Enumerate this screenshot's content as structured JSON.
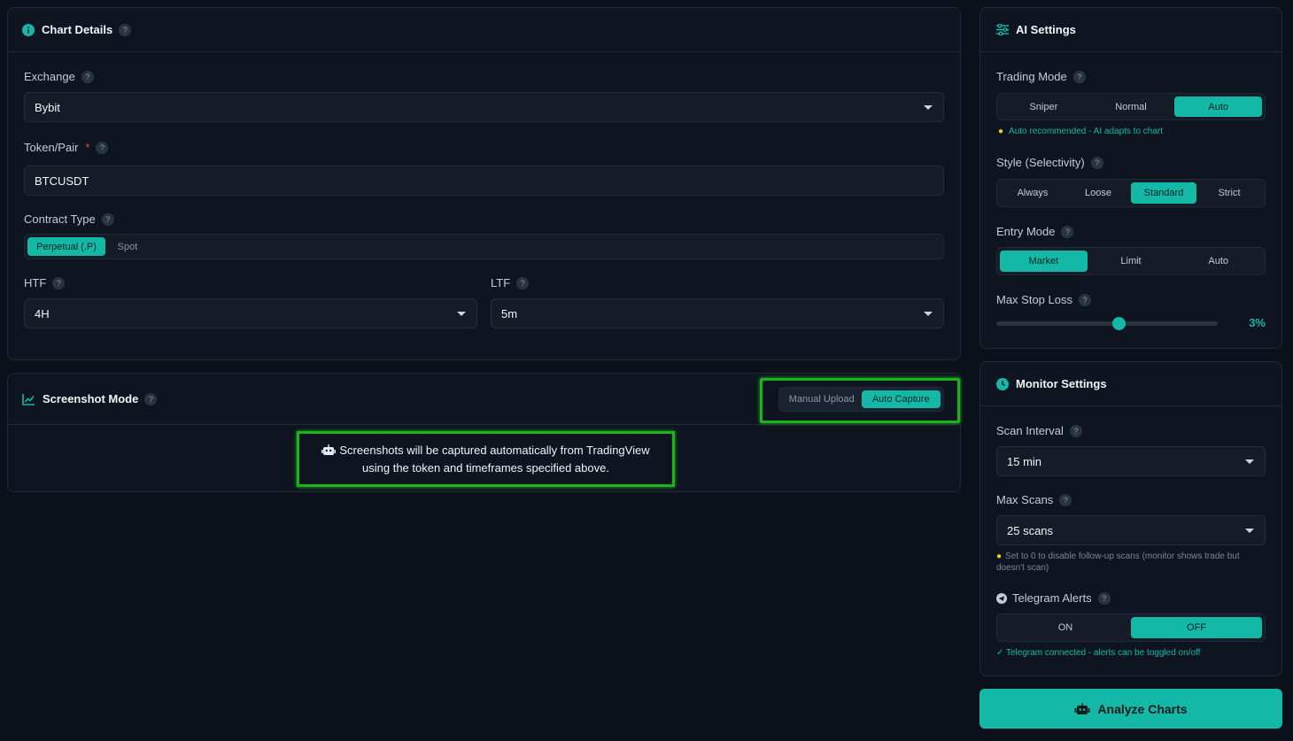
{
  "chart_details": {
    "title": "Chart Details",
    "exchange_label": "Exchange",
    "exchange_value": "Bybit",
    "token_label": "Token/Pair",
    "token_value": "BTCUSDT",
    "contract_label": "Contract Type",
    "contract_options": [
      "Perpetual (.P)",
      "Spot"
    ],
    "contract_selected": "Perpetual (.P)",
    "htf_label": "HTF",
    "htf_value": "4H",
    "ltf_label": "LTF",
    "ltf_value": "5m"
  },
  "screenshot_mode": {
    "title": "Screenshot Mode",
    "options": [
      "Manual Upload",
      "Auto Capture"
    ],
    "selected": "Auto Capture",
    "message_line1": "Screenshots will be captured automatically from TradingView",
    "message_line2": "using the token and timeframes specified above."
  },
  "ai_settings": {
    "title": "AI Settings",
    "trading_mode_label": "Trading Mode",
    "trading_mode_options": [
      "Sniper",
      "Normal",
      "Auto"
    ],
    "trading_mode_selected": "Auto",
    "trading_mode_hint": "Auto recommended - AI adapts to chart",
    "style_label": "Style (Selectivity)",
    "style_options": [
      "Always",
      "Loose",
      "Standard",
      "Strict"
    ],
    "style_selected": "Standard",
    "entry_label": "Entry Mode",
    "entry_options": [
      "Market",
      "Limit",
      "Auto"
    ],
    "entry_selected": "Market",
    "stop_loss_label": "Max Stop Loss",
    "stop_loss_value": "3%",
    "stop_loss_fraction": 0.55
  },
  "monitor_settings": {
    "title": "Monitor Settings",
    "scan_interval_label": "Scan Interval",
    "scan_interval_value": "15 min",
    "max_scans_label": "Max Scans",
    "max_scans_value": "25 scans",
    "max_scans_hint": "Set to 0 to disable follow-up scans (monitor shows trade but doesn't scan)",
    "telegram_label": "Telegram Alerts",
    "telegram_options": [
      "ON",
      "OFF"
    ],
    "telegram_selected": "OFF",
    "telegram_status": "✓ Telegram connected - alerts can be toggled on/off"
  },
  "analyze_button_label": "Analyze Charts",
  "help_glyph": "?",
  "required_mark": "*",
  "colors": {
    "accent": "#14b8a6",
    "highlight": "#22c55e",
    "background": "#0b111b"
  }
}
